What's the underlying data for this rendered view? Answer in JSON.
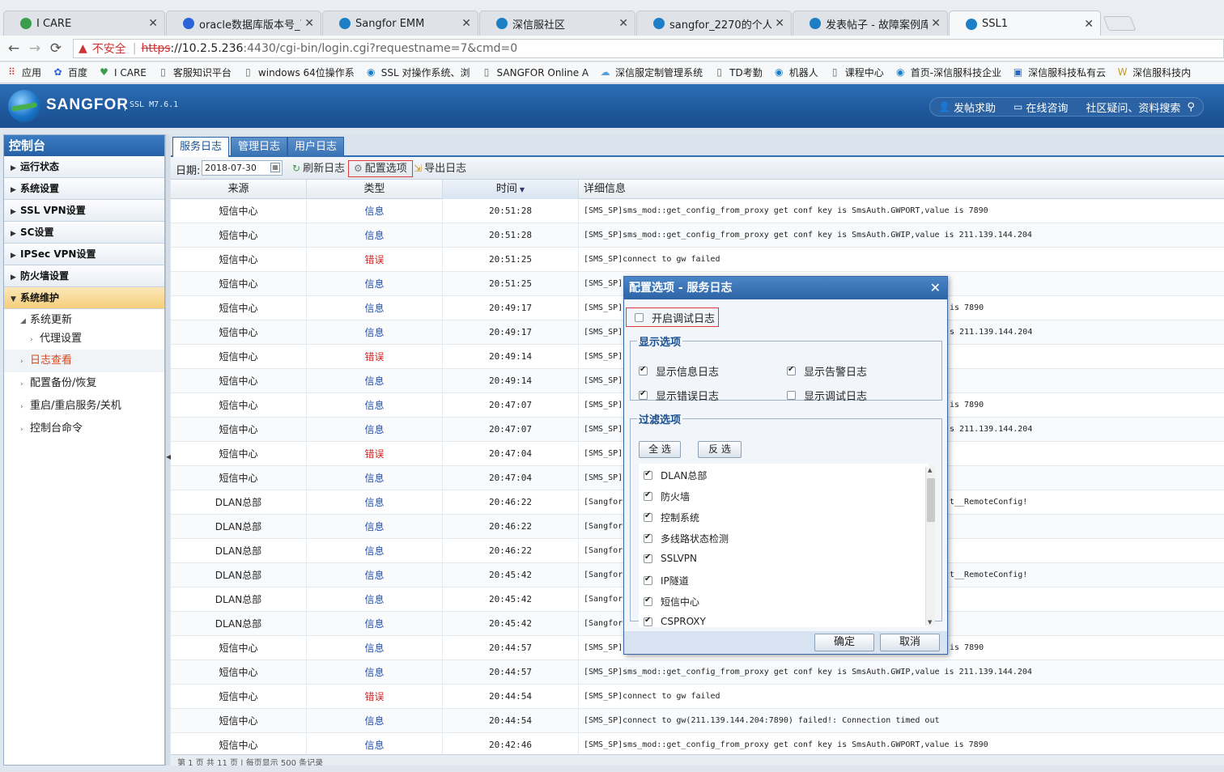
{
  "browser": {
    "tabs": [
      {
        "label": "I CARE",
        "icon": "heart-icon",
        "color": "#3a9d4b"
      },
      {
        "label": "oracle数据库版本号_百度",
        "icon": "paw-icon",
        "color": "#2b63d8"
      },
      {
        "label": "Sangfor EMM",
        "icon": "globe-icon",
        "color": "#1c7fc5"
      },
      {
        "label": "深信服社区",
        "icon": "globe-icon",
        "color": "#1c7fc5"
      },
      {
        "label": "sangfor_2270的个人资料",
        "icon": "globe-icon",
        "color": "#1c7fc5"
      },
      {
        "label": "发表帖子 - 故障案例库 -",
        "icon": "globe-icon",
        "color": "#1c7fc5"
      },
      {
        "label": "SSL1",
        "icon": "globe-icon",
        "color": "#1c7fc5"
      }
    ],
    "insecure_label": "不安全",
    "url_scheme": "https",
    "url_host": "://10.2.5.236",
    "url_rest": ":4430/cgi-bin/login.cgi?requestname=7&cmd=0",
    "bookmarks": [
      {
        "label": "应用",
        "icon": "apps-icon"
      },
      {
        "label": "百度",
        "icon": "paw-icon"
      },
      {
        "label": "I CARE",
        "icon": "heart-icon"
      },
      {
        "label": "客服知识平台",
        "icon": "page-icon"
      },
      {
        "label": "windows 64位操作系",
        "icon": "page-icon"
      },
      {
        "label": "SSL 对操作系统、浏",
        "icon": "globe-icon"
      },
      {
        "label": "SANGFOR Online A",
        "icon": "page-icon"
      },
      {
        "label": "深信服定制管理系统",
        "icon": "cloud-icon"
      },
      {
        "label": "TD考勤",
        "icon": "page-icon"
      },
      {
        "label": "机器人",
        "icon": "globe-icon"
      },
      {
        "label": "课程中心",
        "icon": "page-icon"
      },
      {
        "label": "首页-深信服科技企业",
        "icon": "globe-icon"
      },
      {
        "label": "深信服科技私有云",
        "icon": "dsm-icon"
      },
      {
        "label": "深信服科技内",
        "icon": "w-icon"
      }
    ]
  },
  "header": {
    "brand": "SANGFOR",
    "version": "SSL M7.6.1",
    "links": [
      "发帖求助",
      "在线咨询",
      "社区疑问、资料搜索"
    ]
  },
  "sidebar": {
    "title": "控制台",
    "items": [
      "运行状态",
      "系统设置",
      "SSL VPN设置",
      "SC设置",
      "IPSec VPN设置",
      "防火墙设置"
    ],
    "open_item": "系统维护",
    "sub_group": "系统更新",
    "sub_group_child": "代理设置",
    "subs": [
      "日志查看",
      "配置备份/恢复",
      "重启/重启服务/关机",
      "控制台命令"
    ]
  },
  "log_tabs": [
    "服务日志",
    "管理日志",
    "用户日志"
  ],
  "toolbar": {
    "date_label": "日期:",
    "date_value": "2018-07-30",
    "refresh": "刷新日志",
    "config": "配置选项",
    "export": "导出日志"
  },
  "grid": {
    "headers": [
      "来源",
      "类型",
      "时间",
      "详细信息"
    ],
    "rows": [
      {
        "src": "短信中心",
        "type": "信息",
        "err": false,
        "time": "20:51:28",
        "det": "[SMS_SP]sms_mod::get_config_from_proxy get conf key is SmsAuth.GWPORT,value is 7890"
      },
      {
        "src": "短信中心",
        "type": "信息",
        "err": false,
        "time": "20:51:28",
        "det": "[SMS_SP]sms_mod::get_config_from_proxy get conf key is SmsAuth.GWIP,value is 211.139.144.204"
      },
      {
        "src": "短信中心",
        "type": "错误",
        "err": true,
        "time": "20:51:25",
        "det": "[SMS_SP]connect to gw failed"
      },
      {
        "src": "短信中心",
        "type": "信息",
        "err": false,
        "time": "20:51:25",
        "det": "[SMS_SP]"
      },
      {
        "src": "短信中心",
        "type": "信息",
        "err": false,
        "time": "20:49:17",
        "det": "[SMS_SP]"
      },
      {
        "src": "短信中心",
        "type": "信息",
        "err": false,
        "time": "20:49:17",
        "det": "[SMS_SP]"
      },
      {
        "src": "短信中心",
        "type": "错误",
        "err": true,
        "time": "20:49:14",
        "det": "[SMS_SP]"
      },
      {
        "src": "短信中心",
        "type": "信息",
        "err": false,
        "time": "20:49:14",
        "det": "[SMS_SP]"
      },
      {
        "src": "短信中心",
        "type": "信息",
        "err": false,
        "time": "20:47:07",
        "det": "[SMS_SP]"
      },
      {
        "src": "短信中心",
        "type": "信息",
        "err": false,
        "time": "20:47:07",
        "det": "[SMS_SP]"
      },
      {
        "src": "短信中心",
        "type": "错误",
        "err": true,
        "time": "20:47:04",
        "det": "[SMS_SP]"
      },
      {
        "src": "短信中心",
        "type": "信息",
        "err": false,
        "time": "20:47:04",
        "det": "[SMS_SP]"
      },
      {
        "src": "DLAN总部",
        "type": "信息",
        "err": false,
        "time": "20:46:22",
        "det": "[Sangfor]"
      },
      {
        "src": "DLAN总部",
        "type": "信息",
        "err": false,
        "time": "20:46:22",
        "det": "[Sangfor]"
      },
      {
        "src": "DLAN总部",
        "type": "信息",
        "err": false,
        "time": "20:46:22",
        "det": "[Sangfor]"
      },
      {
        "src": "DLAN总部",
        "type": "信息",
        "err": false,
        "time": "20:45:42",
        "det": "[Sangfor]"
      },
      {
        "src": "DLAN总部",
        "type": "信息",
        "err": false,
        "time": "20:45:42",
        "det": "[Sangfor]"
      },
      {
        "src": "DLAN总部",
        "type": "信息",
        "err": false,
        "time": "20:45:42",
        "det": "[Sangfor]"
      },
      {
        "src": "短信中心",
        "type": "信息",
        "err": false,
        "time": "20:44:57",
        "det": "[SMS_SP]"
      },
      {
        "src": "短信中心",
        "type": "信息",
        "err": false,
        "time": "20:44:57",
        "det": "[SMS_SP]sms_mod::get_config_from_proxy get conf key is SmsAuth.GWIP,value is 211.139.144.204"
      },
      {
        "src": "短信中心",
        "type": "错误",
        "err": true,
        "time": "20:44:54",
        "det": "[SMS_SP]connect to gw failed"
      },
      {
        "src": "短信中心",
        "type": "信息",
        "err": false,
        "time": "20:44:54",
        "det": "[SMS_SP]connect to gw(211.139.144.204:7890) failed!: Connection timed out"
      },
      {
        "src": "短信中心",
        "type": "信息",
        "err": false,
        "time": "20:42:46",
        "det": "[SMS_SP]sms_mod::get_config_from_proxy get conf key is SmsAuth.GWPORT,value is 7890"
      }
    ],
    "right_fragments": [
      {
        "row": 4,
        "text": "is 7890"
      },
      {
        "row": 5,
        "text": "s 211.139.144.204"
      },
      {
        "row": 8,
        "text": "is 7890"
      },
      {
        "row": 9,
        "text": "s 211.139.144.204"
      },
      {
        "row": 12,
        "text": "t__RemoteConfig!"
      },
      {
        "row": 15,
        "text": "t__RemoteConfig!"
      },
      {
        "row": 18,
        "text": "is 7890"
      }
    ],
    "pager_text": "第 1 页 共 11 页 | 每页显示 500 条记录"
  },
  "dialog": {
    "title": "配置选项 - 服务日志",
    "debug_label": "开启调试日志",
    "debug_checked": false,
    "display_legend": "显示选项",
    "display_opts": [
      {
        "label": "显示信息日志",
        "checked": true
      },
      {
        "label": "显示告警日志",
        "checked": true
      },
      {
        "label": "显示错误日志",
        "checked": true
      },
      {
        "label": "显示调试日志",
        "checked": false
      }
    ],
    "filter_legend": "过滤选项",
    "select_all": "全 选",
    "invert": "反 选",
    "filters": [
      "DLAN总部",
      "防火墙",
      "控制系统",
      "多线路状态检测",
      "SSLVPN",
      "IP隧道",
      "短信中心",
      "CSPROXY"
    ],
    "ok": "确定",
    "cancel": "取消"
  }
}
